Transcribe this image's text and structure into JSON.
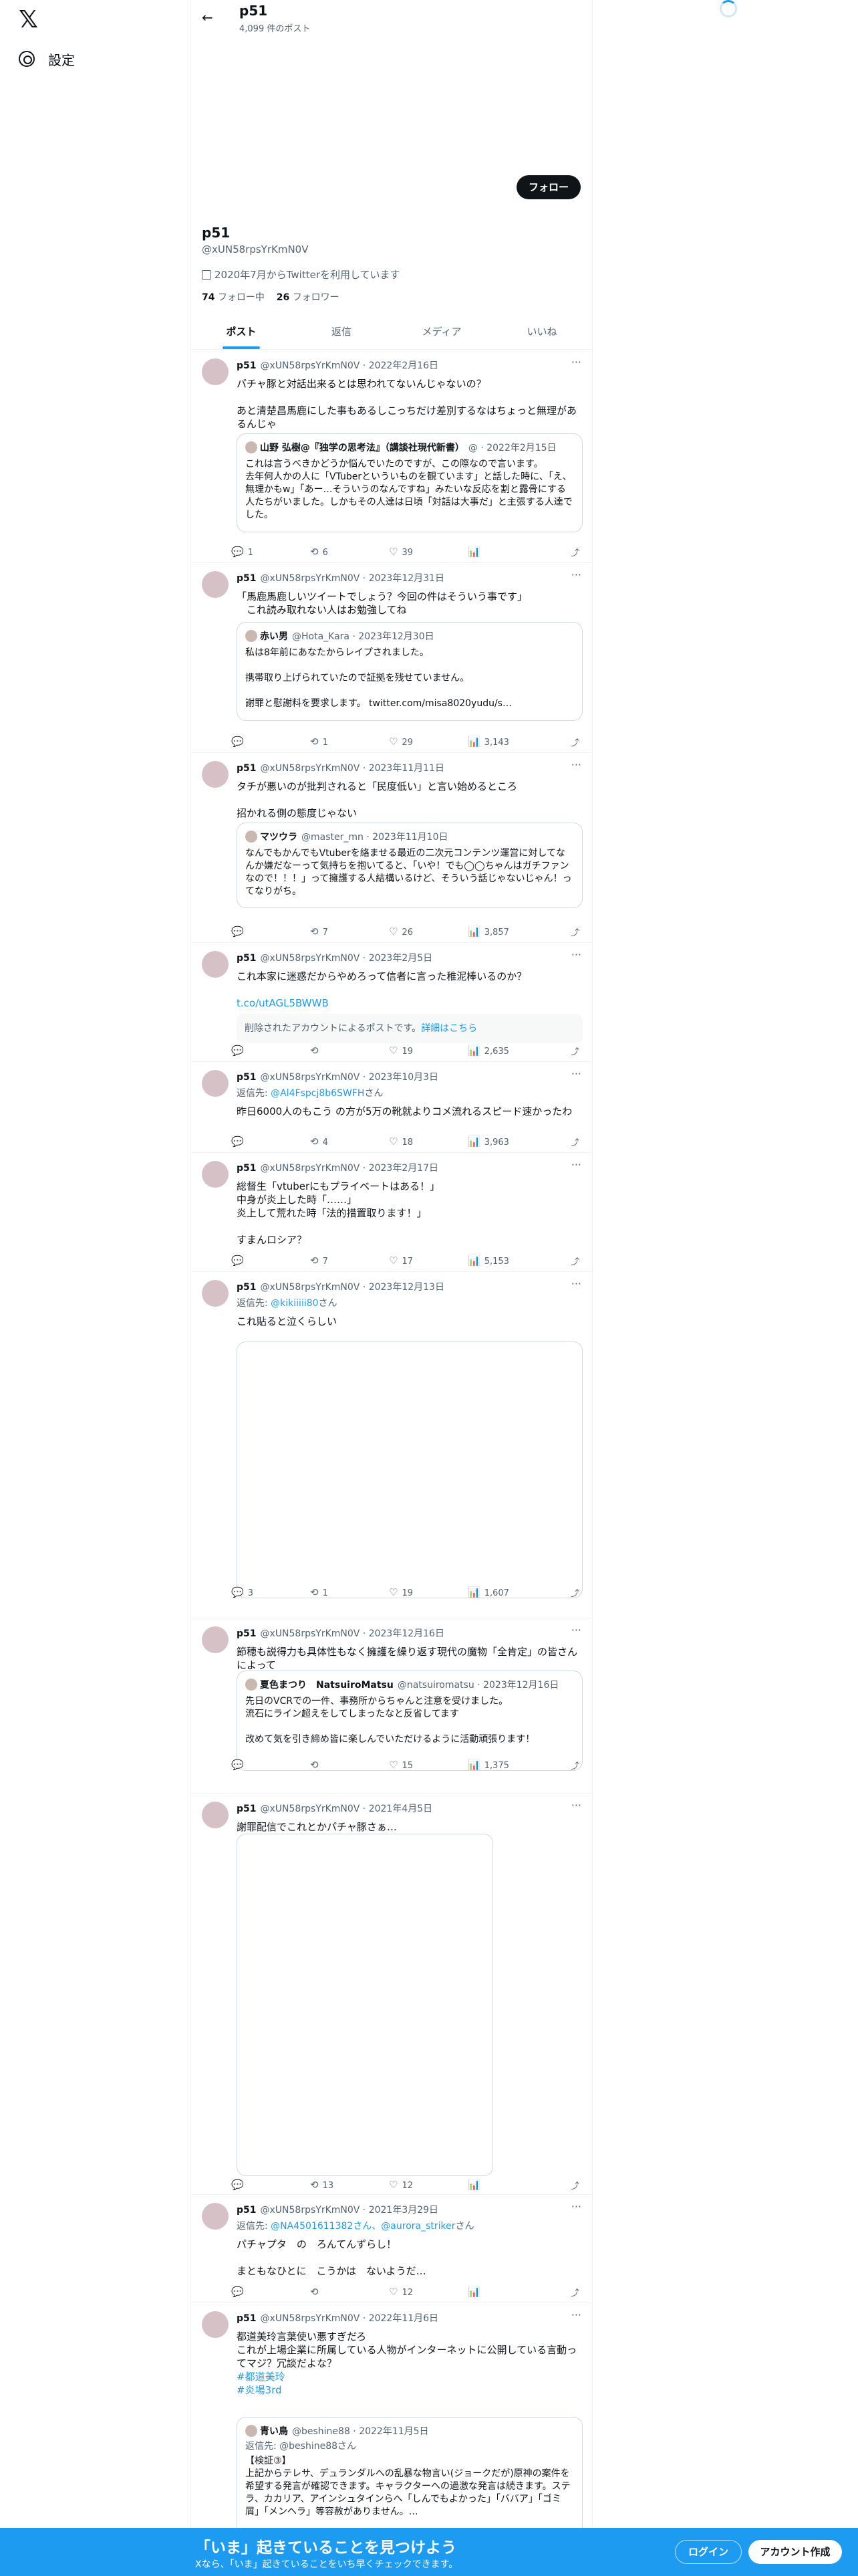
{
  "colors": {
    "accent": "#1d9bf0",
    "text": "#0f1419",
    "muted": "#536471",
    "border": "#cfd9de"
  },
  "left": {
    "logo": "𝕏",
    "settings": "設定"
  },
  "header": {
    "name": "p51",
    "posts": "4,099 件のポスト"
  },
  "profile": {
    "follow": "フォロー",
    "name": "p51",
    "handle": "@xUN58rpsYrKmN0V",
    "joined": "2020年7月からTwitterを利用しています",
    "following_count": "74",
    "following_label": "フォロー中",
    "followers_count": "26",
    "followers_label": "フォロワー"
  },
  "tabs": [
    "ポスト",
    "返信",
    "メディア",
    "いいね"
  ],
  "tweets": [
    {
      "name": "p51",
      "meta": "@xUN58rpsYrKmN0V · 2022年2月16日",
      "text": "パチャ豚と対話出来るとは思われてないんじゃないの？\n\nあと清楚昌馬鹿にした事もあるしこっちだけ差別するなはちょっと無理があるんじゃ",
      "quote": {
        "name": "山野 弘樹@『独学の思考法』（講談社現代新書）",
        "meta": "@ · 2022年2月15日",
        "text": "これは言うべきかどうか悩んでいたのですが、この際なので言います。\n去年何人かの人に「VTuberといういものを観ています」と話した時に、「え、無理かもw」「あー…そういうのなんですね」みたいな反応を割と露骨にする人たちがいました。しかもその人達は日頃「対話は大事だ」と主張する人達でした。"
      },
      "reply": "1",
      "rt": "6",
      "like": "39",
      "views": ""
    },
    {
      "name": "p51",
      "meta": "@xUN58rpsYrKmN0V · 2023年12月31日",
      "text": "「馬鹿馬鹿しいツイートでしょう？今回の件はそういう事です」\n　これ読み取れない人はお勉強してね",
      "quote": {
        "name": "赤い男",
        "meta": "@Hota_Kara · 2023年12月30日",
        "text": "私は8年前にあなたからレイプされました。\n\n携帯取り上げられていたので証拠を残せていません。\n\n謝罪と慰謝料を要求します。 twitter.com/misa8020yudu/s…"
      },
      "reply": "",
      "rt": "1",
      "like": "29",
      "views": "3,143"
    },
    {
      "name": "p51",
      "meta": "@xUN58rpsYrKmN0V · 2023年11月11日",
      "text": "タチが悪いのが批判されると「民度低い」と言い始めるところ\n\n招かれる側の態度じゃない",
      "quote": {
        "name": "マツウラ",
        "meta": "@master_mn · 2023年11月10日",
        "text": "なんでもかんでもVtuberを絡ませる最近の二次元コンテンツ運営に対してなんか嫌だなーって気持ちを抱いてると、「いや！でも◯◯ちゃんはガチファンなので！！！」って擁護する人結構いるけど、そういう話じゃないじゃん！ってなりがち。"
      },
      "reply": "",
      "rt": "7",
      "like": "26",
      "views": "3,857"
    },
    {
      "name": "p51",
      "meta": "@xUN58rpsYrKmN0V · 2023年2月5日",
      "text": "これ本家に迷惑だからやめろって信者に言った稚泥棒いるのか？",
      "link": "t.co/utAGL5BWWB",
      "deleted": "削除されたアカウントによるポストです。",
      "deleted_link": "詳細はこちら",
      "reply": "",
      "rt": "",
      "like": "19",
      "views": "2,635"
    },
    {
      "name": "p51",
      "meta": "@xUN58rpsYrKmN0V · 2023年10月3日",
      "reply_to": "返信先: ",
      "reply_to_handle": "@Al4Fspcj8b6SWFH",
      "reply_suffix": "さん",
      "text": "昨日6000人のもこう の方が5万の靴就よりコメ流れるスピード速かったわ",
      "reply": "",
      "rt": "4",
      "like": "18",
      "views": "3,963"
    },
    {
      "name": "p51",
      "meta": "@xUN58rpsYrKmN0V · 2023年2月17日",
      "text": "総督生「vtuberにもプライベートはある！」\n中身が炎上した時「……」\n炎上して荒れた時「法的措置取ります！」\n\nすまんロシア？",
      "reply": "",
      "rt": "7",
      "like": "17",
      "views": "5,153"
    },
    {
      "name": "p51",
      "meta": "@xUN58rpsYrKmN0V · 2023年12月13日",
      "reply_to": "返信先: ",
      "reply_to_handle": "@kikiiiii80",
      "reply_suffix": "さん",
      "text": "これ貼ると泣くらしい",
      "reply": "3",
      "rt": "1",
      "like": "19",
      "views": "1,607"
    },
    {
      "name": "p51",
      "meta": "@xUN58rpsYrKmN0V · 2023年12月16日",
      "text": "節穂も説得力も具体性もなく擁護を繰り返す現代の魔物「全肯定」の皆さんによって",
      "quote": {
        "name": "夏色まつり　NatsuiroMatsu",
        "meta": "@natsuiromatsu · 2023年12月16日",
        "text": "先日のVCRでの一件、事務所からちゃんと注意を受けました。\n流石にライン超えをしてしまったなと反省してます\n\n改めて気を引き締め皆に楽しんでいただけるように活動頑張ります！"
      },
      "reply": "",
      "rt": "",
      "like": "15",
      "views": "1,375"
    },
    {
      "name": "p51",
      "meta": "@xUN58rpsYrKmN0V · 2021年4月5日",
      "text": "謝罪配信でこれとかパチャ豚さぁ…",
      "reply": "",
      "rt": "13",
      "like": "12",
      "views": ""
    },
    {
      "name": "p51",
      "meta": "@xUN58rpsYrKmN0V · 2021年3月29日",
      "reply_to": "返信先: ",
      "reply_to_handle": "@NA4501611382さん、@aurora_striker",
      "reply_suffix": "さん",
      "text": "パチャプタ　の　ろんてんずらし！\n\nまともなひとに　こうかは　ないようだ…",
      "reply": "",
      "rt": "",
      "like": "12",
      "views": ""
    },
    {
      "name": "p51",
      "meta": "@xUN58rpsYrKmN0V · 2022年11月6日",
      "text": "都道美玲言葉使い悪すぎだろ\nこれが上場企業に所属している人物がインターネットに公開している言動ってマジ？冗談だよな？",
      "tags": [
        "#都道美玲",
        "#炎場3rd"
      ],
      "quote": {
        "name": "青い鳥",
        "meta": "@beshine88 · 2022年11月5日",
        "reply_to": "返信先: @beshine88さん",
        "text": "【検証③】\n上記からテレサ、デュランダルへの乱暴な物言い(ジョークだが)原神の案件を希望する発言が確認できます。キャラクターへの過激な発言は続きます。ステラ、カカリア、アインシュタインらへ「しんでもよかった」「ババア」「ゴミ屑」「メンヘラ」等容赦がありません。…"
      }
    }
  ],
  "bottom": {
    "title": "「いま」起きていることを見つけよう",
    "sub": "Xなら、「いま」起きていることをいち早くチェックできます。",
    "login": "ログイン",
    "signup": "アカウント作成"
  }
}
